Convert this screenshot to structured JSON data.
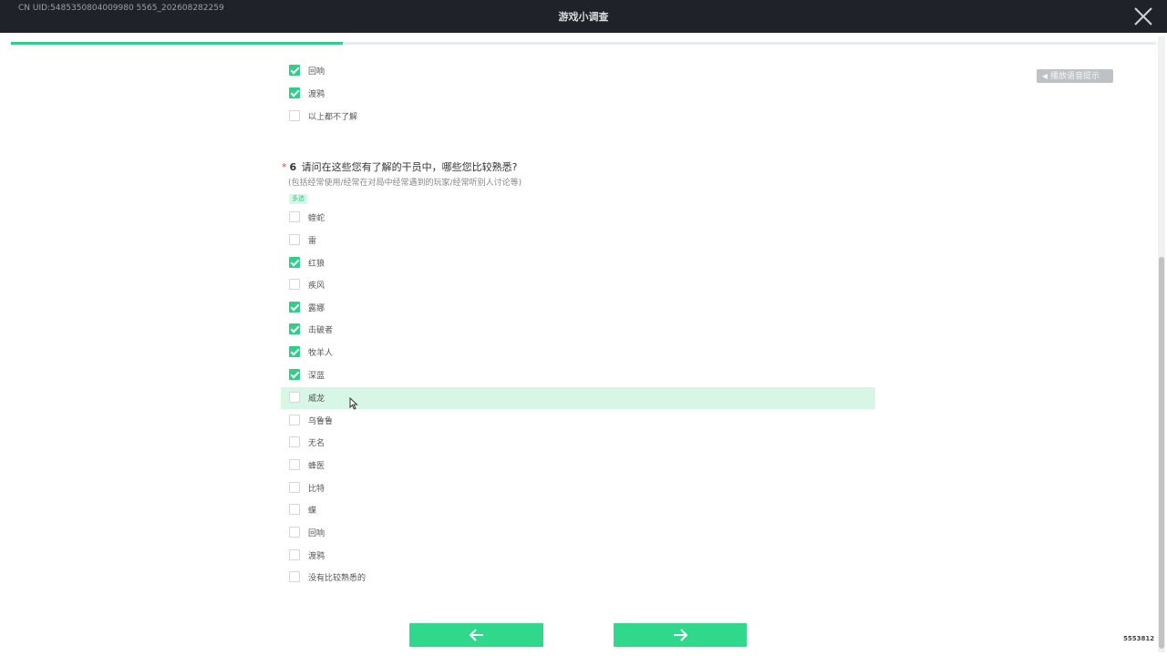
{
  "header": {
    "uid": "CN UID:5485350804009980 5565_202608282259",
    "title": "游戏小调查",
    "close_icon": "close-icon"
  },
  "progress": {
    "fraction": 0.29
  },
  "hint": {
    "icon": "speaker-icon",
    "text": "播放语音提示"
  },
  "previous_options": [
    {
      "label": "回响",
      "checked": true
    },
    {
      "label": "渡鸦",
      "checked": true
    },
    {
      "label": "以上都不了解",
      "checked": false
    }
  ],
  "question": {
    "required_mark": "*",
    "number": "6",
    "text": "请问在这些您有了解的干员中，哪些您比较熟悉?",
    "subtext": "(包括经常使用/经常在对局中经常遇到的玩家/经常听别人讨论等)",
    "tag": "多选",
    "options": [
      {
        "label": "蝰蛇",
        "checked": false
      },
      {
        "label": "雷",
        "checked": false
      },
      {
        "label": "红狼",
        "checked": true
      },
      {
        "label": "疾风",
        "checked": false
      },
      {
        "label": "露娜",
        "checked": true
      },
      {
        "label": "击破者",
        "checked": true
      },
      {
        "label": "牧羊人",
        "checked": true
      },
      {
        "label": "深蓝",
        "checked": true
      },
      {
        "label": "威龙",
        "checked": false
      },
      {
        "label": "乌鲁鲁",
        "checked": false
      },
      {
        "label": "无名",
        "checked": false
      },
      {
        "label": "蜂医",
        "checked": false
      },
      {
        "label": "比特",
        "checked": false
      },
      {
        "label": "蝶",
        "checked": false
      },
      {
        "label": "回响",
        "checked": false
      },
      {
        "label": "渡鸦",
        "checked": false
      },
      {
        "label": "没有比较熟悉的",
        "checked": false
      }
    ]
  },
  "nav": {
    "prev_icon": "arrow-left-icon",
    "next_icon": "arrow-right-icon"
  },
  "page_code": "5553812",
  "colors": {
    "accent": "#2ecf86",
    "header_bg": "#1f2329",
    "hover_bg": "#d8f6e6"
  }
}
